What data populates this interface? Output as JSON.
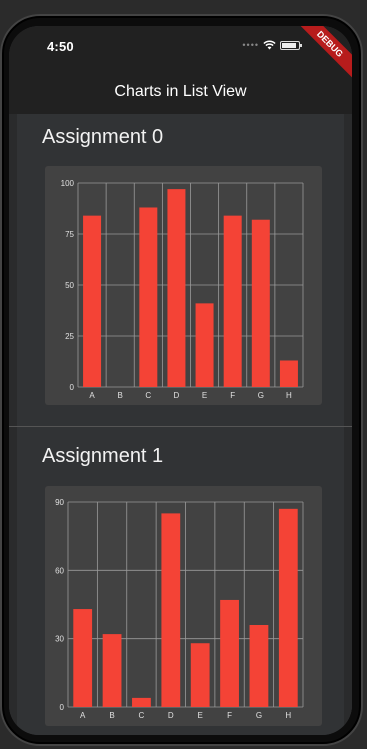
{
  "status_bar": {
    "time": "4:50"
  },
  "debug_banner": "DEBUG",
  "app_bar": {
    "title": "Charts in List View"
  },
  "colors": {
    "bar": "#F44336",
    "grid": "#9a9a9a",
    "axis_text": "#e0e0e0",
    "card": "#424242"
  },
  "chart_data": [
    {
      "type": "bar",
      "title": "Assignment 0",
      "categories": [
        "A",
        "B",
        "C",
        "D",
        "E",
        "F",
        "G",
        "H"
      ],
      "values": [
        84,
        0,
        88,
        97,
        41,
        84,
        82,
        13
      ],
      "yticks": [
        "0",
        "25",
        "50",
        "75",
        "100"
      ],
      "ylim": [
        0,
        100
      ],
      "grid": true
    },
    {
      "type": "bar",
      "title": "Assignment 1",
      "categories": [
        "A",
        "B",
        "C",
        "D",
        "E",
        "F",
        "G",
        "H"
      ],
      "values": [
        43,
        32,
        4,
        85,
        28,
        47,
        36,
        87
      ],
      "yticks": [
        "0",
        "30",
        "60",
        "90"
      ],
      "ylim": [
        0,
        90
      ],
      "grid": true
    }
  ]
}
